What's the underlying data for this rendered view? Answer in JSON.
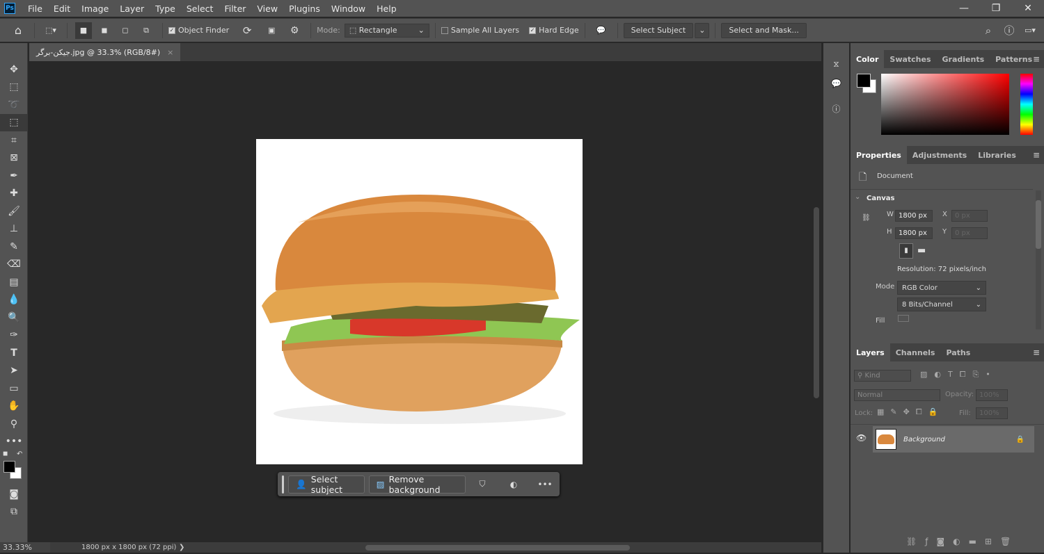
{
  "app": {
    "logo": "Ps"
  },
  "menu": [
    "File",
    "Edit",
    "Image",
    "Layer",
    "Type",
    "Select",
    "Filter",
    "View",
    "Plugins",
    "Window",
    "Help"
  ],
  "window_controls": {
    "minimize": "—",
    "restore": "❐",
    "close": "✕"
  },
  "options": {
    "object_finder": "Object Finder",
    "object_finder_checked": true,
    "mode_label": "Mode:",
    "mode_value": "Rectangle",
    "sample_all_layers": "Sample All Layers",
    "sample_all_checked": false,
    "hard_edge": "Hard Edge",
    "hard_edge_checked": true,
    "select_subject": "Select Subject",
    "select_and_mask": "Select and Mask..."
  },
  "document": {
    "tab_title": "جیکن-برگر.jpg @ 33.3% (RGB/8#)",
    "close": "×"
  },
  "context_bar": {
    "select_subject": "Select subject",
    "remove_background": "Remove background",
    "more": "•••"
  },
  "status": {
    "zoom": "33.33%",
    "info": "1800 px x 1800 px (72 ppi)",
    "arrow": "❯"
  },
  "color_panel": {
    "tabs": [
      "Color",
      "Swatches",
      "Gradients",
      "Patterns"
    ],
    "active": "Color",
    "foreground": "#000000",
    "background": "#ffffff",
    "hue": "#ff0000"
  },
  "properties_panel": {
    "tabs": [
      "Properties",
      "Adjustments",
      "Libraries"
    ],
    "active": "Properties",
    "document_label": "Document",
    "section": "Canvas",
    "w_label": "W",
    "w_value": "1800 px",
    "h_label": "H",
    "h_value": "1800 px",
    "x_label": "X",
    "x_value": "0 px",
    "y_label": "Y",
    "y_value": "0 px",
    "resolution": "Resolution: 72 pixels/inch",
    "mode_label": "Mode",
    "mode_value": "RGB Color",
    "bits_value": "8 Bits/Channel",
    "fill_label": "Fill"
  },
  "layers_panel": {
    "tabs": [
      "Layers",
      "Channels",
      "Paths"
    ],
    "active": "Layers",
    "kind_placeholder": "Kind",
    "blend_mode": "Normal",
    "opacity_label": "Opacity:",
    "opacity_value": "100%",
    "lock_label": "Lock:",
    "fill_label": "Fill:",
    "fill_value": "100%",
    "layers": [
      {
        "name": "Background",
        "visible": true,
        "locked": true
      }
    ]
  }
}
